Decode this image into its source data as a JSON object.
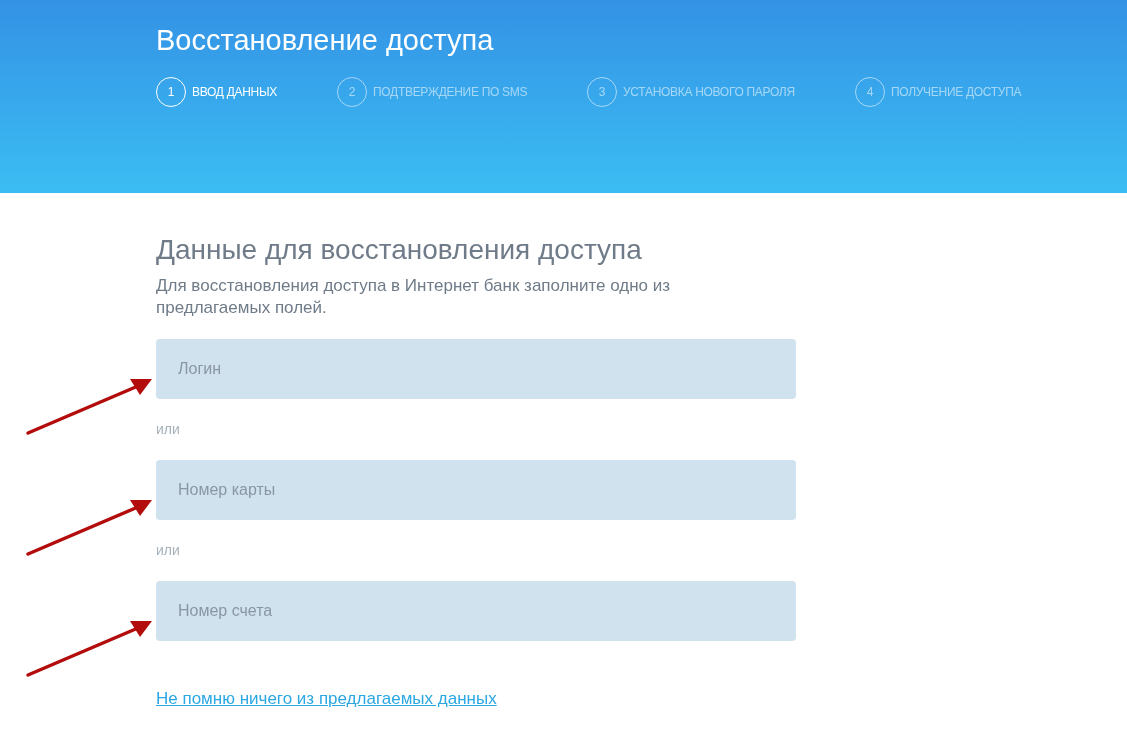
{
  "header": {
    "title": "Восстановление доступа",
    "steps": [
      {
        "number": "1",
        "label": "ВВОД ДАННЫХ",
        "selected": true
      },
      {
        "number": "2",
        "label": "ПОДТВЕРЖДЕНИЕ ПО SMS",
        "selected": false
      },
      {
        "number": "3",
        "label": "УСТАНОВКА НОВОГО ПАРОЛЯ",
        "selected": false
      },
      {
        "number": "4",
        "label": "ПОЛУЧЕНИЕ ДОСТУПА",
        "selected": false
      }
    ]
  },
  "form": {
    "heading": "Данные для восстановления доступа",
    "description": "Для восстановления доступа в Интернет банк заполните одно из предлагаемых полей.",
    "fields": [
      {
        "placeholder": "Логин",
        "annotated": true
      },
      {
        "placeholder": "Номер карты",
        "annotated": true
      },
      {
        "placeholder": "Номер счета",
        "annotated": true
      }
    ],
    "separators": [
      "или",
      "или"
    ],
    "link": "Не помню ничего из предлагаемых данных"
  }
}
